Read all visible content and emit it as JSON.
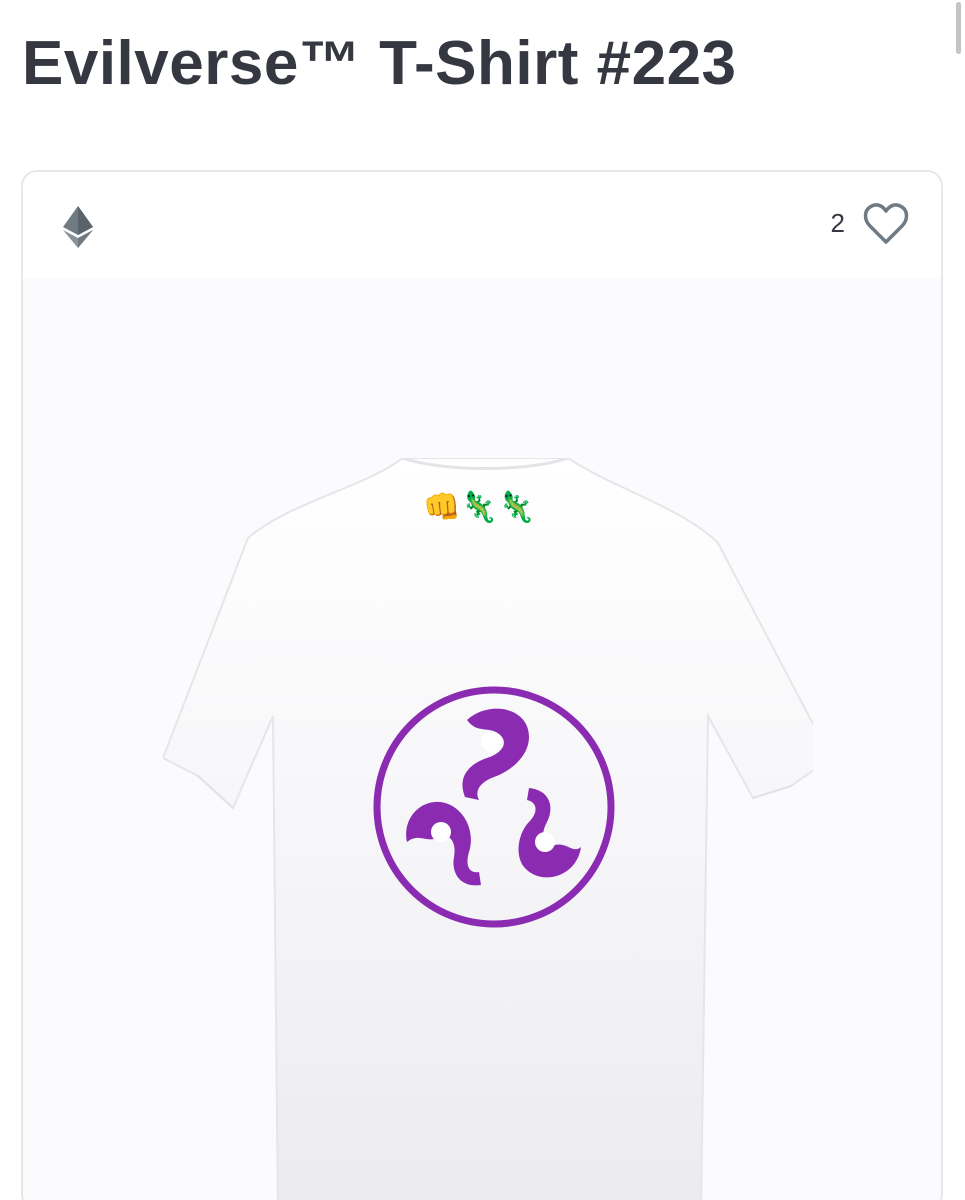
{
  "page": {
    "title": "Evilverse™ T-Shirt #223"
  },
  "card": {
    "chain_icon": "ethereum-icon",
    "favorite_count": "2",
    "favorite_icon": "heart-outline-icon"
  },
  "artwork": {
    "subject": "white t-shirt back view",
    "neck_emoji": "👊🦎🦎",
    "logo_icon": "purple-triskelion-circle-logo",
    "colors": {
      "logo": "#8a2bb2",
      "shirt": "#f7f7fa"
    }
  }
}
